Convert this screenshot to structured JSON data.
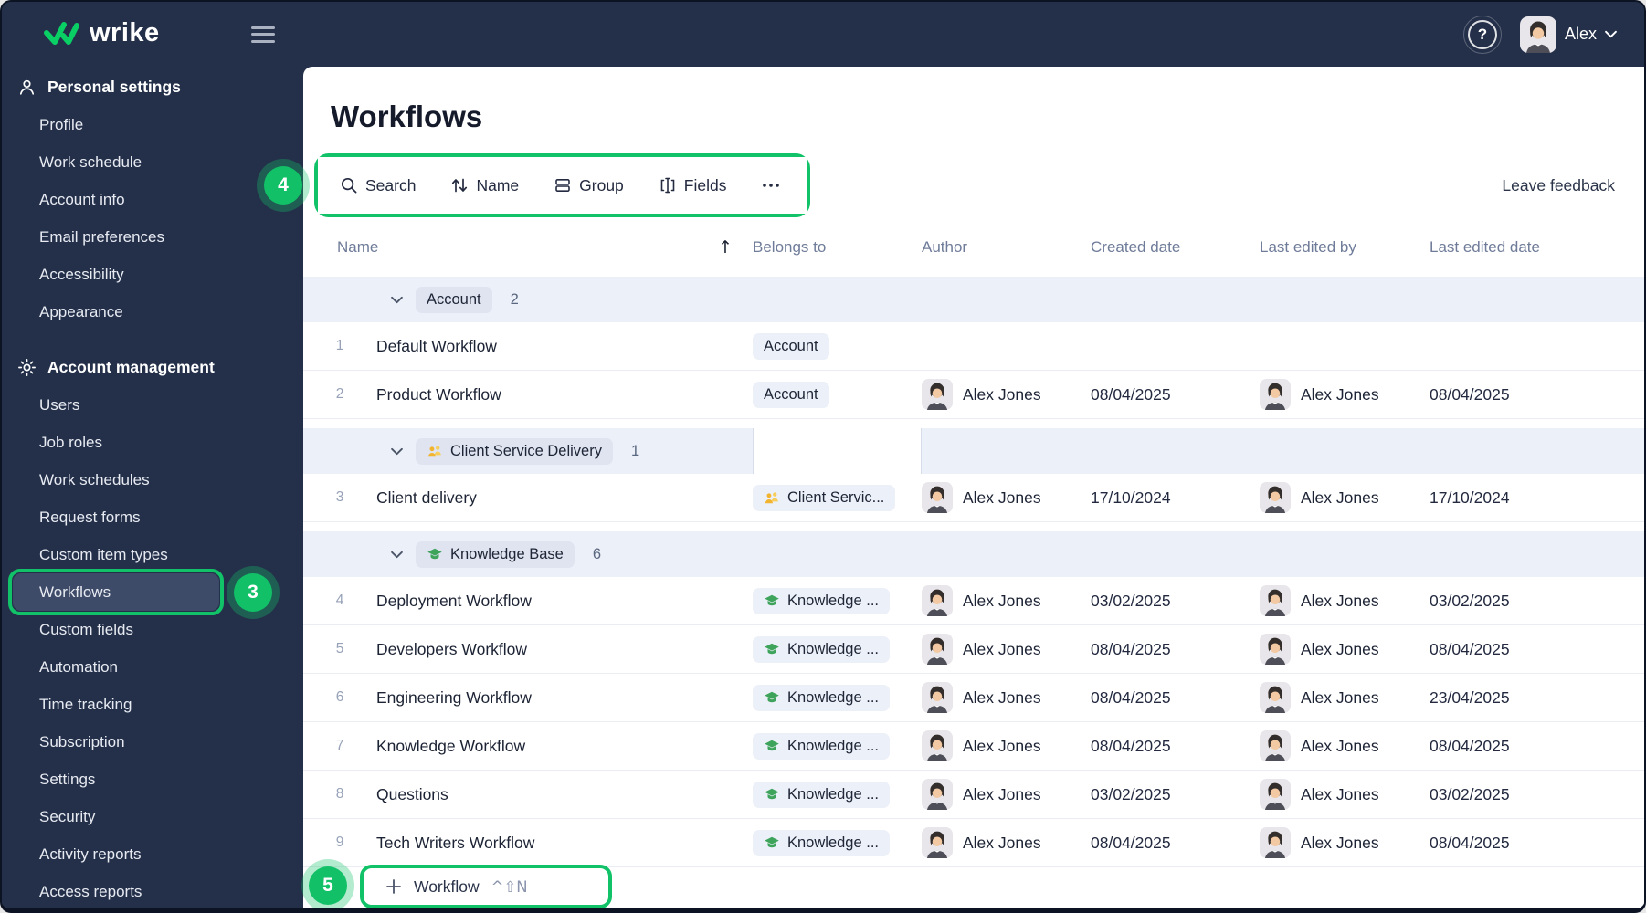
{
  "topbar": {
    "logo_text": "wrike",
    "user": {
      "name": "Alex"
    }
  },
  "annotations": {
    "sidebar_step": "3",
    "toolbar_step": "4",
    "add_button_step": "5"
  },
  "sidebar": {
    "sections": [
      {
        "label": "Personal settings",
        "icon": "person-icon",
        "items": [
          {
            "label": "Profile"
          },
          {
            "label": "Work schedule"
          },
          {
            "label": "Account info"
          },
          {
            "label": "Email preferences"
          },
          {
            "label": "Accessibility"
          },
          {
            "label": "Appearance"
          }
        ]
      },
      {
        "label": "Account management",
        "icon": "gear-icon",
        "items": [
          {
            "label": "Users"
          },
          {
            "label": "Job roles"
          },
          {
            "label": "Work schedules"
          },
          {
            "label": "Request forms"
          },
          {
            "label": "Custom item types"
          },
          {
            "label": "Workflows",
            "selected": true,
            "annotation": "3"
          },
          {
            "label": "Custom fields"
          },
          {
            "label": "Automation"
          },
          {
            "label": "Time tracking"
          },
          {
            "label": "Subscription"
          },
          {
            "label": "Settings"
          },
          {
            "label": "Security"
          },
          {
            "label": "Activity reports"
          },
          {
            "label": "Access reports"
          }
        ]
      }
    ]
  },
  "main": {
    "title": "Workflows",
    "leave_feedback": "Leave feedback",
    "toolbar": {
      "items": [
        {
          "label": "Search",
          "icon": "search-icon"
        },
        {
          "label": "Name",
          "icon": "sort-icon"
        },
        {
          "label": "Group",
          "icon": "group-icon"
        },
        {
          "label": "Fields",
          "icon": "fields-icon"
        },
        {
          "label": "",
          "icon": "more-icon"
        }
      ]
    }
  },
  "table": {
    "columns": [
      {
        "label": "Name",
        "sort": "asc"
      },
      {
        "label": "Belongs to"
      },
      {
        "label": "Author"
      },
      {
        "label": "Created date"
      },
      {
        "label": "Last edited by"
      },
      {
        "label": "Last edited date"
      }
    ],
    "sort_indicator": "↑",
    "groups": [
      {
        "label": "Account",
        "icon": null,
        "count": "2",
        "rows": [
          {
            "num": "1",
            "name": "Default Workflow",
            "belongs": "Account",
            "belongs_icon": null,
            "author": "",
            "created": "",
            "edited_by": "",
            "edited": ""
          },
          {
            "num": "2",
            "name": "Product Workflow",
            "belongs": "Account",
            "belongs_icon": null,
            "author": "Alex Jones",
            "created": "08/04/2025",
            "edited_by": "Alex Jones",
            "edited": "08/04/2025"
          }
        ]
      },
      {
        "label": "Client Service Delivery",
        "icon": "team-icon",
        "count": "1",
        "highlight_belongs_cell": true,
        "rows": [
          {
            "num": "3",
            "name": "Client delivery",
            "belongs": "Client Servic...",
            "belongs_icon": "team-icon",
            "author": "Alex Jones",
            "created": "17/10/2024",
            "edited_by": "Alex Jones",
            "edited": "17/10/2024"
          }
        ]
      },
      {
        "label": "Knowledge Base",
        "icon": "grad-cap-icon",
        "count": "6",
        "rows": [
          {
            "num": "4",
            "name": "Deployment Workflow",
            "belongs": "Knowledge ...",
            "belongs_icon": "grad-cap-icon",
            "author": "Alex Jones",
            "created": "03/02/2025",
            "edited_by": "Alex Jones",
            "edited": "03/02/2025"
          },
          {
            "num": "5",
            "name": "Developers Workflow",
            "belongs": "Knowledge ...",
            "belongs_icon": "grad-cap-icon",
            "author": "Alex Jones",
            "created": "08/04/2025",
            "edited_by": "Alex Jones",
            "edited": "08/04/2025"
          },
          {
            "num": "6",
            "name": "Engineering Workflow",
            "belongs": "Knowledge ...",
            "belongs_icon": "grad-cap-icon",
            "author": "Alex Jones",
            "created": "08/04/2025",
            "edited_by": "Alex Jones",
            "edited": "23/04/2025"
          },
          {
            "num": "7",
            "name": "Knowledge Workflow",
            "belongs": "Knowledge ...",
            "belongs_icon": "grad-cap-icon",
            "author": "Alex Jones",
            "created": "08/04/2025",
            "edited_by": "Alex Jones",
            "edited": "08/04/2025"
          },
          {
            "num": "8",
            "name": "Questions",
            "belongs": "Knowledge ...",
            "belongs_icon": "grad-cap-icon",
            "author": "Alex Jones",
            "created": "03/02/2025",
            "edited_by": "Alex Jones",
            "edited": "03/02/2025"
          },
          {
            "num": "9",
            "name": "Tech Writers Workflow",
            "belongs": "Knowledge ...",
            "belongs_icon": "grad-cap-icon",
            "author": "Alex Jones",
            "created": "08/04/2025",
            "edited_by": "Alex Jones",
            "edited": "08/04/2025"
          }
        ]
      }
    ]
  },
  "footer": {
    "add_label": "Workflow",
    "shortcut": "^⇧N"
  },
  "colors": {
    "navy": "#24304A",
    "annotation_green": "#12C268",
    "logo_green": "#0ACF65",
    "group_row_bg": "#ECF0F8",
    "band_pill_bg": "#DFE4F0",
    "row_pill_bg": "#ECF0F8",
    "header_text": "#6F7C99",
    "body_text": "#1C2334",
    "team_icon_gold": "#F2B32F",
    "grad_cap_green": "#3EA35B"
  },
  "icons": {
    "search-icon": "magnifier",
    "sort-icon": "up-down-arrows",
    "group-icon": "stacked-rows",
    "fields-icon": "column-selector",
    "more-icon": "three-dots",
    "person-icon": "person-outline",
    "gear-icon": "gear-outline",
    "team-icon": "two-people-gold",
    "grad-cap-icon": "graduation-cap-green",
    "chevron-down-icon": "chevron-down",
    "plus-icon": "plus",
    "help-icon": "question-mark-circle",
    "menu-icon": "hamburger"
  }
}
